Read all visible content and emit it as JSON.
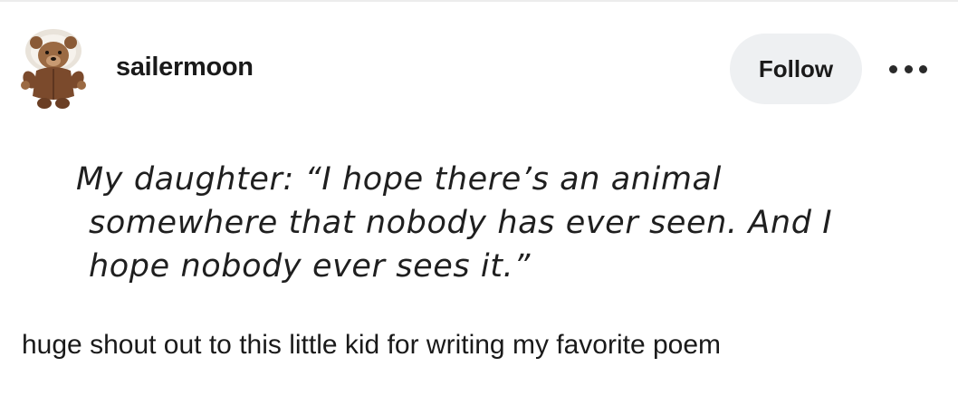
{
  "post": {
    "username": "sailermoon",
    "avatar_icon": "teddy-bear-avatar-icon",
    "follow_label": "Follow",
    "more_icon": "more-options-icon",
    "quote_lines": [
      "My daughter: “I hope there’s an animal",
      "somewhere that nobody has ever seen. And I",
      "hope nobody ever sees it.”"
    ],
    "caption": "huge shout out to this little kid for writing my favorite poem"
  },
  "colors": {
    "follow_bg": "#eef0f2",
    "text": "#1a1a1a"
  }
}
